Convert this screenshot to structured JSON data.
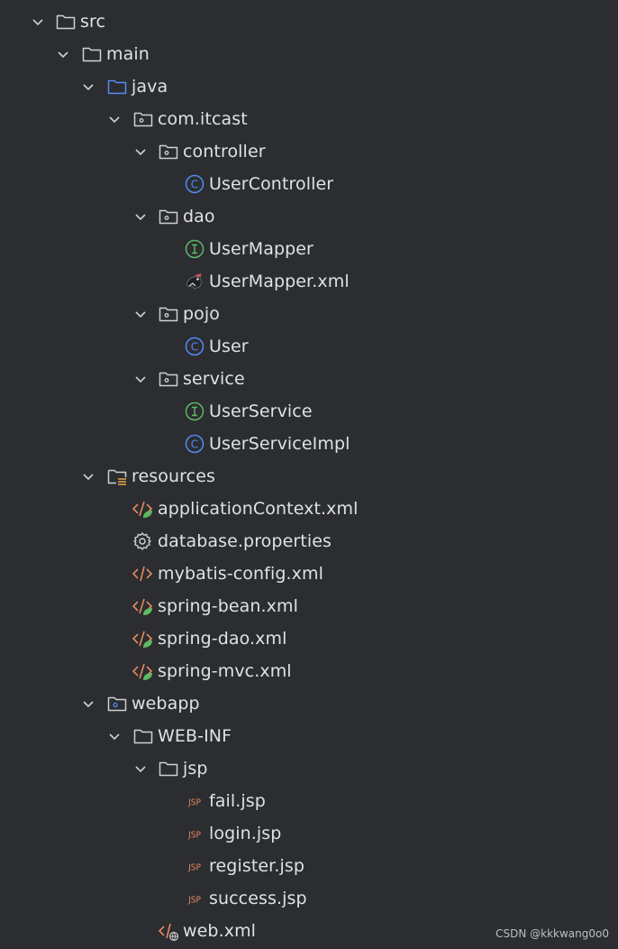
{
  "tree": {
    "items": [
      {
        "label": "src",
        "icon": "folder-icon",
        "level": 0,
        "expanded": true
      },
      {
        "label": "main",
        "icon": "folder-icon",
        "level": 1,
        "expanded": true
      },
      {
        "label": "java",
        "icon": "source-folder-icon",
        "level": 2,
        "expanded": true
      },
      {
        "label": "com.itcast",
        "icon": "package-icon",
        "level": 3,
        "expanded": true
      },
      {
        "label": "controller",
        "icon": "package-icon",
        "level": 4,
        "expanded": true
      },
      {
        "label": "UserController",
        "icon": "class-icon",
        "level": 5
      },
      {
        "label": "dao",
        "icon": "package-icon",
        "level": 4,
        "expanded": true
      },
      {
        "label": "UserMapper",
        "icon": "interface-icon",
        "level": 5
      },
      {
        "label": "UserMapper.xml",
        "icon": "mybatis-icon",
        "level": 5
      },
      {
        "label": "pojo",
        "icon": "package-icon",
        "level": 4,
        "expanded": true
      },
      {
        "label": "User",
        "icon": "class-icon",
        "level": 5
      },
      {
        "label": "service",
        "icon": "package-icon",
        "level": 4,
        "expanded": true
      },
      {
        "label": "UserService",
        "icon": "interface-icon",
        "level": 5
      },
      {
        "label": "UserServiceImpl",
        "icon": "class-icon",
        "level": 5
      },
      {
        "label": "resources",
        "icon": "resources-folder-icon",
        "level": 2,
        "expanded": true
      },
      {
        "label": "applicationContext.xml",
        "icon": "spring-xml-icon",
        "level": 3
      },
      {
        "label": "database.properties",
        "icon": "gear-icon",
        "level": 3
      },
      {
        "label": "mybatis-config.xml",
        "icon": "xml-icon",
        "level": 3
      },
      {
        "label": "spring-bean.xml",
        "icon": "spring-xml-icon",
        "level": 3
      },
      {
        "label": "spring-dao.xml",
        "icon": "spring-xml-icon",
        "level": 3
      },
      {
        "label": "spring-mvc.xml",
        "icon": "spring-xml-icon",
        "level": 3
      },
      {
        "label": "webapp",
        "icon": "web-folder-icon",
        "level": 2,
        "expanded": true
      },
      {
        "label": "WEB-INF",
        "icon": "folder-icon",
        "level": 3,
        "expanded": true
      },
      {
        "label": "jsp",
        "icon": "folder-icon",
        "level": 4,
        "expanded": true
      },
      {
        "label": "fail.jsp",
        "icon": "jsp-icon",
        "level": 5
      },
      {
        "label": "login.jsp",
        "icon": "jsp-icon",
        "level": 5
      },
      {
        "label": "register.jsp",
        "icon": "jsp-icon",
        "level": 5
      },
      {
        "label": "success.jsp",
        "icon": "jsp-icon",
        "level": 5
      },
      {
        "label": "web.xml",
        "icon": "web-xml-icon",
        "level": 4
      }
    ]
  },
  "watermark": "CSDN @kkkwang0o0",
  "colors": {
    "background": "#2b2d30",
    "text": "#dfe1e5",
    "class": "#548af7",
    "interface": "#5fb865",
    "xml": "#e6885f",
    "spring": "#5fb865",
    "jsp": "#e6885f",
    "folder": "#ced0d6",
    "source_folder": "#548af7"
  }
}
